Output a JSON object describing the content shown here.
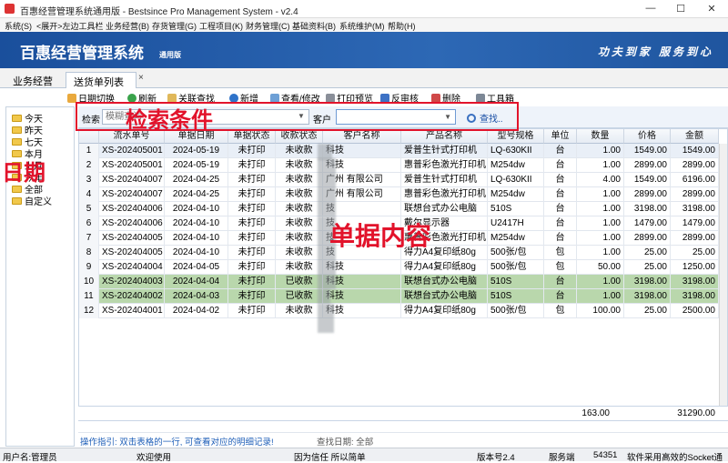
{
  "window": {
    "title": "百惠经营管理系统通用版 - Bestsince Pro Management System - v2.4",
    "minimize": "—",
    "maximize": "☐",
    "close": "✕"
  },
  "menu": [
    "系统(S)",
    "<展开>左边工具栏",
    "业务经营(B)",
    "存货管理(G)",
    "工程项目(K)",
    "财务管理(C)",
    "基础资料(B)",
    "系统维护(M)",
    "帮助(H)"
  ],
  "banner": {
    "title": "百惠经营管理系统",
    "edition": "通用版",
    "slogan": "功夫到家  服务到心"
  },
  "tabs": {
    "module": "业务经营",
    "active": "送货单列表",
    "close": "×"
  },
  "toolbar": [
    "日期切换",
    "刷新",
    "关联查找",
    "新增",
    "查看/修改",
    "打印预览",
    "反审核",
    "删除",
    "工具箱"
  ],
  "tree": [
    "今天",
    "昨天",
    "七天",
    "本月",
    "上月",
    "今年",
    "全部",
    "自定义"
  ],
  "search": {
    "label": "检索",
    "placeholder": "模糊查询",
    "customer_label": "客户",
    "customer_value": "",
    "find_button": "查找.."
  },
  "grid": {
    "columns": [
      "",
      "流水单号",
      "单据日期",
      "单据状态",
      "收款状态",
      "客户名称",
      "产品名称",
      "型号规格",
      "单位",
      "数量",
      "价格",
      "金额"
    ],
    "rows": [
      {
        "n": "1",
        "no": "XS-202405001",
        "date": "2024-05-19",
        "doc": "未打印",
        "pay": "未收款",
        "cust": "科技",
        "prod": "爱普生针式打印机",
        "model": "LQ-630KII",
        "unit": "台",
        "qty": "1.00",
        "price": "1549.00",
        "amt": "1549.00"
      },
      {
        "n": "2",
        "no": "XS-202405001",
        "date": "2024-05-19",
        "doc": "未打印",
        "pay": "未收款",
        "cust": "科技",
        "prod": "惠普彩色激光打印机",
        "model": "M254dw",
        "unit": "台",
        "qty": "1.00",
        "price": "2899.00",
        "amt": "2899.00"
      },
      {
        "n": "3",
        "no": "XS-202404007",
        "date": "2024-04-25",
        "doc": "未打印",
        "pay": "未收款",
        "cust": "广州            有限公司",
        "prod": "爱普生针式打印机",
        "model": "LQ-630KII",
        "unit": "台",
        "qty": "4.00",
        "price": "1549.00",
        "amt": "6196.00"
      },
      {
        "n": "4",
        "no": "XS-202404007",
        "date": "2024-04-25",
        "doc": "未打印",
        "pay": "未收款",
        "cust": "广州            有限公司",
        "prod": "惠普彩色激光打印机",
        "model": "M254dw",
        "unit": "台",
        "qty": "1.00",
        "price": "2899.00",
        "amt": "2899.00"
      },
      {
        "n": "5",
        "no": "XS-202404006",
        "date": "2024-04-10",
        "doc": "未打印",
        "pay": "未收款",
        "cust": "技",
        "prod": "联想台式办公电脑",
        "model": "510S",
        "unit": "台",
        "qty": "1.00",
        "price": "3198.00",
        "amt": "3198.00"
      },
      {
        "n": "6",
        "no": "XS-202404006",
        "date": "2024-04-10",
        "doc": "未打印",
        "pay": "未收款",
        "cust": "技",
        "prod": "戴尔显示器",
        "model": "U2417H",
        "unit": "台",
        "qty": "1.00",
        "price": "1479.00",
        "amt": "1479.00"
      },
      {
        "n": "7",
        "no": "XS-202404005",
        "date": "2024-04-10",
        "doc": "未打印",
        "pay": "未收款",
        "cust": "技",
        "prod": "惠普彩色激光打印机",
        "model": "M254dw",
        "unit": "台",
        "qty": "1.00",
        "price": "2899.00",
        "amt": "2899.00"
      },
      {
        "n": "8",
        "no": "XS-202404005",
        "date": "2024-04-10",
        "doc": "未打印",
        "pay": "未收款",
        "cust": "技",
        "prod": "得力A4复印纸80g",
        "model": "500张/包",
        "unit": "包",
        "qty": "1.00",
        "price": "25.00",
        "amt": "25.00"
      },
      {
        "n": "9",
        "no": "XS-202404004",
        "date": "2024-04-05",
        "doc": "未打印",
        "pay": "未收款",
        "cust": "科技",
        "prod": "得力A4复印纸80g",
        "model": "500张/包",
        "unit": "包",
        "qty": "50.00",
        "price": "25.00",
        "amt": "1250.00"
      },
      {
        "n": "10",
        "no": "XS-202404003",
        "date": "2024-04-04",
        "doc": "未打印",
        "pay": "已收款",
        "cust": "科技",
        "prod": "联想台式办公电脑",
        "model": "510S",
        "unit": "台",
        "qty": "1.00",
        "price": "3198.00",
        "amt": "3198.00",
        "highlight": true
      },
      {
        "n": "11",
        "no": "XS-202404002",
        "date": "2024-04-03",
        "doc": "未打印",
        "pay": "已收款",
        "cust": "科技",
        "prod": "联想台式办公电脑",
        "model": "510S",
        "unit": "台",
        "qty": "1.00",
        "price": "3198.00",
        "amt": "3198.00",
        "highlight": true
      },
      {
        "n": "12",
        "no": "XS-202404001",
        "date": "2024-04-02",
        "doc": "未打印",
        "pay": "未收款",
        "cust": "科技",
        "prod": "得力A4复印纸80g",
        "model": "500张/包",
        "unit": "包",
        "qty": "100.00",
        "price": "25.00",
        "amt": "2500.00"
      }
    ],
    "sum_qty": "163.00",
    "sum_amount": "31290.00"
  },
  "guide": {
    "text": "操作指引: 双击表格的一行, 可查看对应的明细记录!",
    "find_date": "查找日期: 全部"
  },
  "status": {
    "user": "用户名:管理员",
    "welcome": "欢迎使用",
    "motto": "因为信任 所以简单",
    "version": "版本号2.4",
    "service": "服务端",
    "port": "54351",
    "socket": "软件采用高效的Socket通"
  },
  "annotations": {
    "search": "检索条件",
    "date": "日期",
    "content": "单据内容"
  },
  "colors": {
    "banner": "#1f559f",
    "highlight_row": "#b9d7ac",
    "annotation": "#e2132b"
  }
}
